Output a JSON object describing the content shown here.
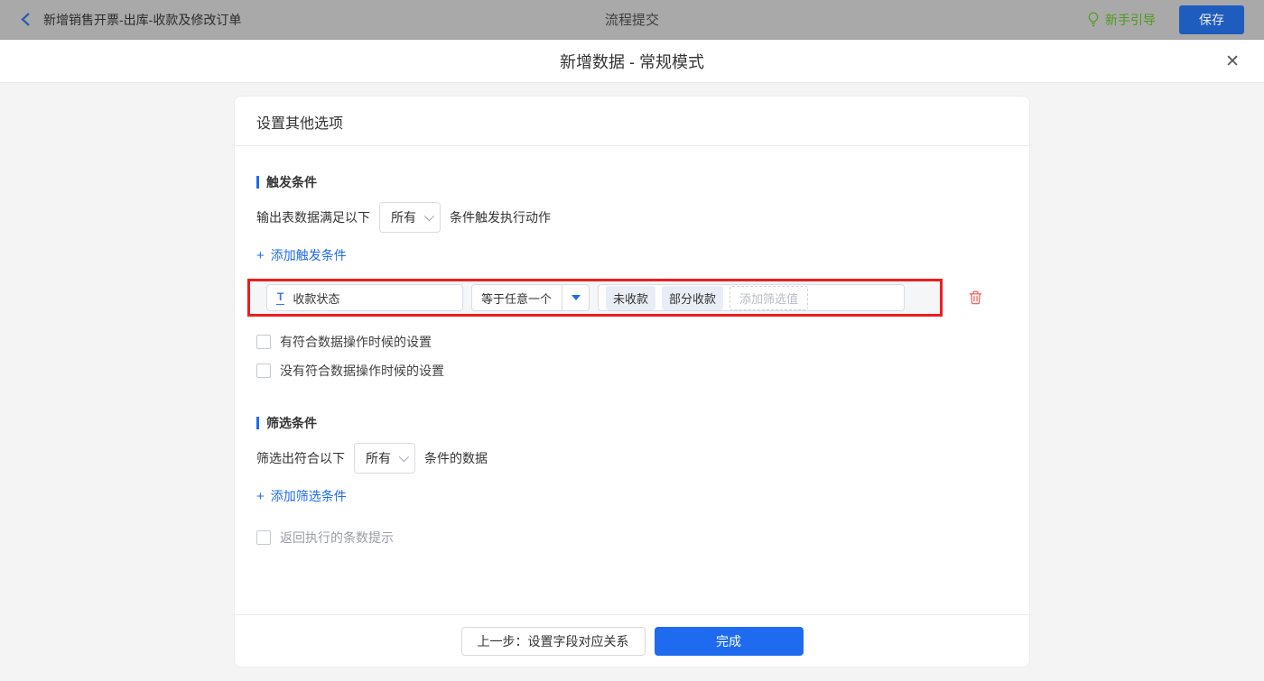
{
  "topbar": {
    "title": "新增销售开票-出库-收款及修改订单",
    "center_title": "流程提交",
    "guide_label": "新手引导",
    "save_label": "保存"
  },
  "modal": {
    "title": "新增数据 - 常规模式",
    "close_glyph": "✕"
  },
  "card": {
    "header": "设置其他选项",
    "trigger": {
      "section_title": "触发条件",
      "sentence_prefix": "输出表数据满足以下",
      "match_select": "所有",
      "sentence_suffix": "条件触发执行动作",
      "add_plus": "+",
      "add_label": "添加触发条件",
      "condition": {
        "field_icon_glyph": "T",
        "field_name": "收款状态",
        "operator": "等于任意一个",
        "values": [
          "未收款",
          "部分收款"
        ],
        "add_value_placeholder": "添加筛选值"
      },
      "checkboxes": [
        "有符合数据操作时候的设置",
        "没有符合数据操作时候的设置"
      ]
    },
    "filter": {
      "section_title": "筛选条件",
      "sentence_prefix": "筛选出符合以下",
      "match_select": "所有",
      "sentence_suffix": "条件的数据",
      "add_plus": "+",
      "add_label": "添加筛选条件",
      "checkbox_label": "返回执行的条数提示"
    },
    "footer": {
      "prev_label": "上一步：设置字段对应关系",
      "done_label": "完成"
    }
  },
  "colors": {
    "accent_blue": "#1e6bf0",
    "highlight_red": "#ee1d1d",
    "guide_green": "#4e9a1d",
    "row_background": "#f5f6f8",
    "tag_background": "#e9edf6"
  }
}
